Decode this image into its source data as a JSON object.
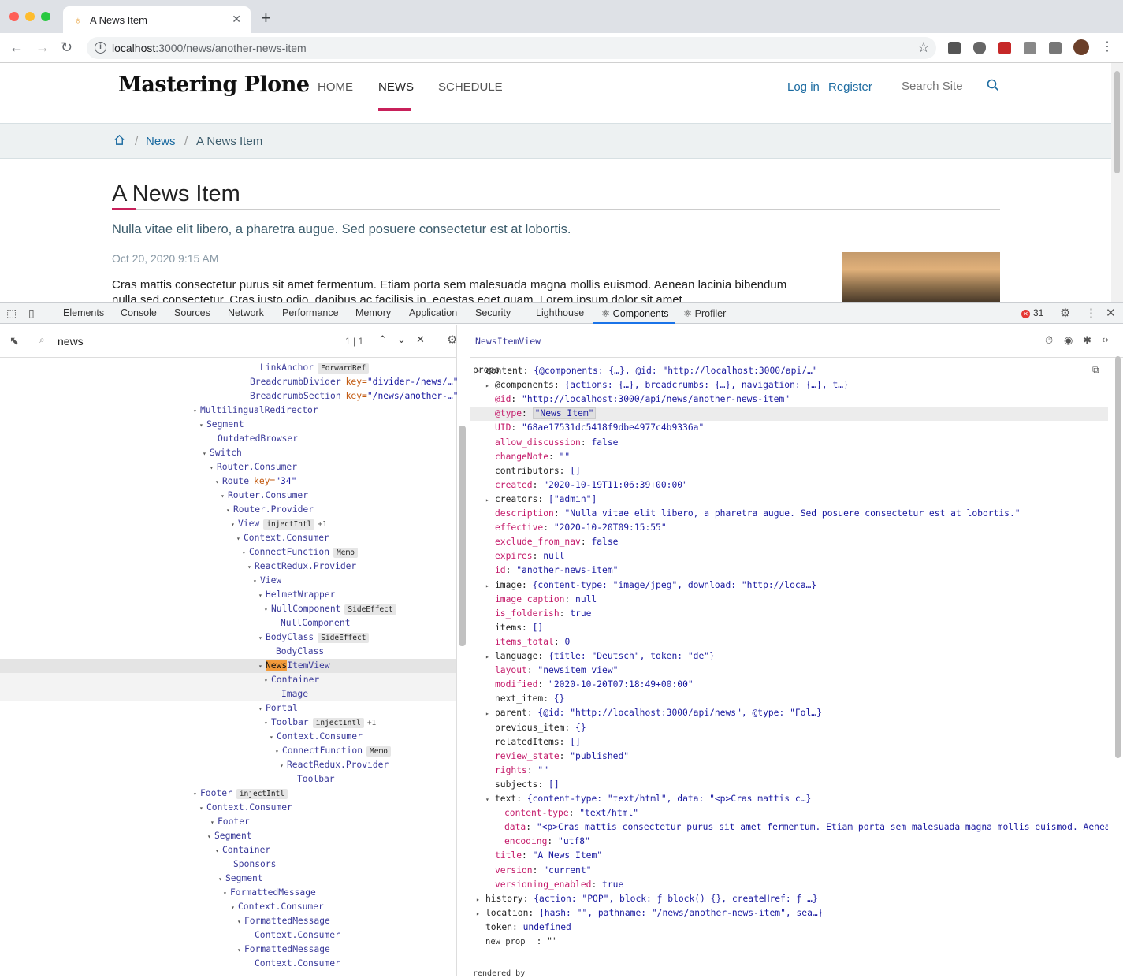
{
  "browser": {
    "tab_title": "A News Item",
    "url_host": "localhost",
    "url_path": ":3000/news/another-news-item",
    "new_tab": "+",
    "tab_close": "✕"
  },
  "site": {
    "logo": "Mastering Plone",
    "nav": [
      "HOME",
      "NEWS",
      "SCHEDULE"
    ],
    "login": "Log in",
    "register": "Register",
    "search_placeholder": "Search Site",
    "breadcrumbs": [
      "News",
      "A News Item"
    ],
    "title": "A News Item",
    "description": "Nulla vitae elit libero, a pharetra augue. Sed posuere consectetur est at lobortis.",
    "date": "Oct 20, 2020 9:15 AM",
    "body": "Cras mattis consectetur purus sit amet fermentum. Etiam porta sem malesuada magna mollis euismod. Aenean lacinia bibendum nulla sed consectetur. Cras justo odio, dapibus ac facilisis in, egestas eget quam. Lorem ipsum dolor sit amet"
  },
  "devtools": {
    "tabs": [
      "Elements",
      "Console",
      "Sources",
      "Network",
      "Performance",
      "Memory",
      "Application",
      "Security",
      "Lighthouse",
      "⚛ Components",
      "⚛ Profiler"
    ],
    "error_count": "31",
    "search_value": "news",
    "search_count": "1 | 1",
    "selected_component": "NewsItemView",
    "props_label": "props"
  },
  "tree": [
    {
      "name": "LinkAnchor",
      "tag": "ForwardRef",
      "arrow": ""
    },
    {
      "name": "BreadcrumbDivider",
      "key": "key=",
      "keyval": "\"divider-/news/…\"",
      "arrow": ""
    },
    {
      "name": "BreadcrumbSection",
      "key": "key=",
      "keyval": "\"/news/another-…\"",
      "arrow": ""
    },
    {
      "name": "MultilingualRedirector",
      "arrow": "▾"
    },
    {
      "name": "Segment",
      "arrow": "▾"
    },
    {
      "name": "OutdatedBrowser",
      "arrow": ""
    },
    {
      "name": "Switch",
      "arrow": "▾"
    },
    {
      "name": "Router.Consumer",
      "arrow": "▾"
    },
    {
      "name": "Route",
      "key": "key=",
      "keyval": "\"34\"",
      "arrow": "▾"
    },
    {
      "name": "Router.Consumer",
      "arrow": "▾"
    },
    {
      "name": "Router.Provider",
      "arrow": "▾"
    },
    {
      "name": "View",
      "tag": "injectIntl",
      "extra": "+1",
      "arrow": "▾"
    },
    {
      "name": "Context.Consumer",
      "arrow": "▾"
    },
    {
      "name": "ConnectFunction",
      "tag": "Memo",
      "arrow": "▾"
    },
    {
      "name": "ReactRedux.Provider",
      "arrow": "▾"
    },
    {
      "name": "View",
      "arrow": "▾"
    },
    {
      "name": "HelmetWrapper",
      "arrow": "▾"
    },
    {
      "name": "NullComponent",
      "tag": "SideEffect",
      "arrow": "▾"
    },
    {
      "name": "NullComponent",
      "arrow": ""
    },
    {
      "name": "BodyClass",
      "tag": "SideEffect",
      "arrow": "▾"
    },
    {
      "name": "BodyClass",
      "arrow": ""
    },
    {
      "name_hl": "News",
      "name_rest": "ItemView",
      "arrow": "▾"
    },
    {
      "name": "Container",
      "arrow": "▾"
    },
    {
      "name": "Image",
      "arrow": ""
    },
    {
      "name": "Portal",
      "arrow": "▾"
    },
    {
      "name": "Toolbar",
      "tag": "injectIntl",
      "extra": "+1",
      "arrow": "▾"
    },
    {
      "name": "Context.Consumer",
      "arrow": "▾"
    },
    {
      "name": "ConnectFunction",
      "tag": "Memo",
      "arrow": "▾"
    },
    {
      "name": "ReactRedux.Provider",
      "arrow": "▾"
    },
    {
      "name": "Toolbar",
      "arrow": ""
    },
    {
      "name": "Footer",
      "tag": "injectIntl",
      "arrow": "▾"
    },
    {
      "name": "Context.Consumer",
      "arrow": "▾"
    },
    {
      "name": "Footer",
      "arrow": "▾"
    },
    {
      "name": "Segment",
      "arrow": "▾"
    },
    {
      "name": "Container",
      "arrow": "▾"
    },
    {
      "name": "Sponsors",
      "arrow": ""
    },
    {
      "name": "Segment",
      "arrow": "▾"
    },
    {
      "name": "FormattedMessage",
      "arrow": "▾"
    },
    {
      "name": "Context.Consumer",
      "arrow": "▾"
    },
    {
      "name": "FormattedMessage",
      "arrow": "▾"
    },
    {
      "name": "Context.Consumer",
      "arrow": ""
    },
    {
      "name": "FormattedMessage",
      "arrow": "▾"
    },
    {
      "name": "Context.Consumer",
      "arrow": ""
    }
  ],
  "props": [
    {
      "k": "content",
      "v": "{@components: {…}, @id: \"http://localhost:3000/api/…\"",
      "arrow": "▾",
      "plain": true
    },
    {
      "k": "@components",
      "v": "{actions: {…}, breadcrumbs: {…}, navigation: {…}, t…}",
      "arrow": "▸",
      "plain": true
    },
    {
      "k": "@id",
      "v": "\"http://localhost:3000/api/news/another-news-item\""
    },
    {
      "k": "@type",
      "v": "\"News Item\"",
      "sel": true
    },
    {
      "k": "UID",
      "v": "\"68ae17531dc5418f9dbe4977c4b9336a\""
    },
    {
      "k": "allow_discussion",
      "v": "false"
    },
    {
      "k": "changeNote",
      "v": "\"\""
    },
    {
      "k": "contributors",
      "v": "[]",
      "plain": true
    },
    {
      "k": "created",
      "v": "\"2020-10-19T11:06:39+00:00\""
    },
    {
      "k": "creators",
      "v": "[\"admin\"]",
      "arrow": "▸",
      "plain": true
    },
    {
      "k": "description",
      "v": "\"Nulla vitae elit libero, a pharetra augue. Sed posuere consectetur est at lobortis.\""
    },
    {
      "k": "effective",
      "v": "\"2020-10-20T09:15:55\""
    },
    {
      "k": "exclude_from_nav",
      "v": "false"
    },
    {
      "k": "expires",
      "v": "null"
    },
    {
      "k": "id",
      "v": "\"another-news-item\""
    },
    {
      "k": "image",
      "v": "{content-type: \"image/jpeg\", download: \"http://loca…}",
      "arrow": "▸",
      "plain": true
    },
    {
      "k": "image_caption",
      "v": "null"
    },
    {
      "k": "is_folderish",
      "v": "true"
    },
    {
      "k": "items",
      "v": "[]",
      "plain": true
    },
    {
      "k": "items_total",
      "v": "0"
    },
    {
      "k": "language",
      "v": "{title: \"Deutsch\", token: \"de\"}",
      "arrow": "▸",
      "plain": true
    },
    {
      "k": "layout",
      "v": "\"newsitem_view\""
    },
    {
      "k": "modified",
      "v": "\"2020-10-20T07:18:49+00:00\""
    },
    {
      "k": "next_item",
      "v": "{}",
      "plain": true
    },
    {
      "k": "parent",
      "v": "{@id: \"http://localhost:3000/api/news\", @type: \"Fol…}",
      "arrow": "▸",
      "plain": true
    },
    {
      "k": "previous_item",
      "v": "{}",
      "plain": true
    },
    {
      "k": "relatedItems",
      "v": "[]",
      "plain": true
    },
    {
      "k": "review_state",
      "v": "\"published\""
    },
    {
      "k": "rights",
      "v": "\"\""
    },
    {
      "k": "subjects",
      "v": "[]",
      "plain": true
    },
    {
      "k": "text",
      "v": "{content-type: \"text/html\", data: \"<p>Cras mattis c…}",
      "arrow": "▾",
      "plain": true
    },
    {
      "k": "content-type",
      "v": "\"text/html\"",
      "deep": true
    },
    {
      "k": "data",
      "v": "\"<p>Cras mattis consectetur purus sit amet fermentum. Etiam porta sem malesuada magna mollis euismod. Aenean",
      "deep": true
    },
    {
      "k": "encoding",
      "v": "\"utf8\"",
      "deep": true
    },
    {
      "k": "title",
      "v": "\"A News Item\""
    },
    {
      "k": "version",
      "v": "\"current\""
    },
    {
      "k": "versioning_enabled",
      "v": "true"
    },
    {
      "k": "history",
      "v": "{action: \"POP\", block: ƒ block() {}, createHref: ƒ …}",
      "arrow": "▸",
      "plain": true,
      "top": true
    },
    {
      "k": "location",
      "v": "{hash: \"\", pathname: \"/news/another-news-item\", sea…}",
      "arrow": "▸",
      "plain": true,
      "top": true
    },
    {
      "k": "token",
      "v": "undefined",
      "plain": true,
      "top": true
    },
    {
      "k": "new prop",
      "v": ": \"\"",
      "top": true,
      "newprop": true
    }
  ],
  "rendered_by": "rendered by"
}
